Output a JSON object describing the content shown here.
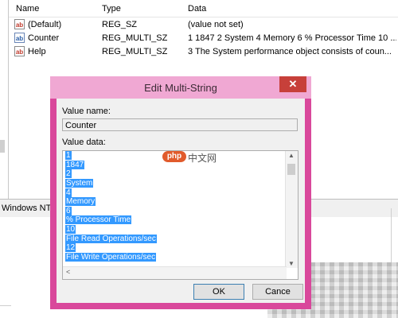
{
  "registry": {
    "columns": {
      "name": "Name",
      "type": "Type",
      "data": "Data"
    },
    "rows": [
      {
        "icon": "ab",
        "name": "(Default)",
        "type": "REG_SZ",
        "data": "(value not set)"
      },
      {
        "icon": "ab",
        "name": "Counter",
        "type": "REG_MULTI_SZ",
        "data": "1 1847 2 System 4 Memory 6 % Processor Time 10 ..."
      },
      {
        "icon": "ab",
        "name": "Help",
        "type": "REG_MULTI_SZ",
        "data": "3 The System performance object consists of coun..."
      }
    ]
  },
  "status_bar": {
    "text": "Windows NT\\"
  },
  "dialog": {
    "title": "Edit Multi-String",
    "close_glyph": "✕",
    "value_name_label": "Value name:",
    "value_name": "Counter",
    "value_data_label": "Value data:",
    "value_data_lines": [
      "1",
      "1847",
      "2",
      "System",
      "4",
      "Memory",
      "6",
      "% Processor Time",
      "10",
      "File Read Operations/sec",
      "12",
      "File Write Operations/sec"
    ],
    "ok_label": "OK",
    "cancel_label": "Cance"
  },
  "watermark": {
    "logo": "php",
    "text": "中文网"
  },
  "colors": {
    "titlebar": "#f0a8d3",
    "frame": "#d9489b",
    "close_button": "#c7403a",
    "selection": "#3399ff"
  },
  "icons": {
    "row_icon": "registry-string-icon",
    "close": "close-icon",
    "scroll_up": "scroll-up-icon",
    "scroll_down": "scroll-down-icon",
    "scroll_left": "scroll-left-icon"
  }
}
